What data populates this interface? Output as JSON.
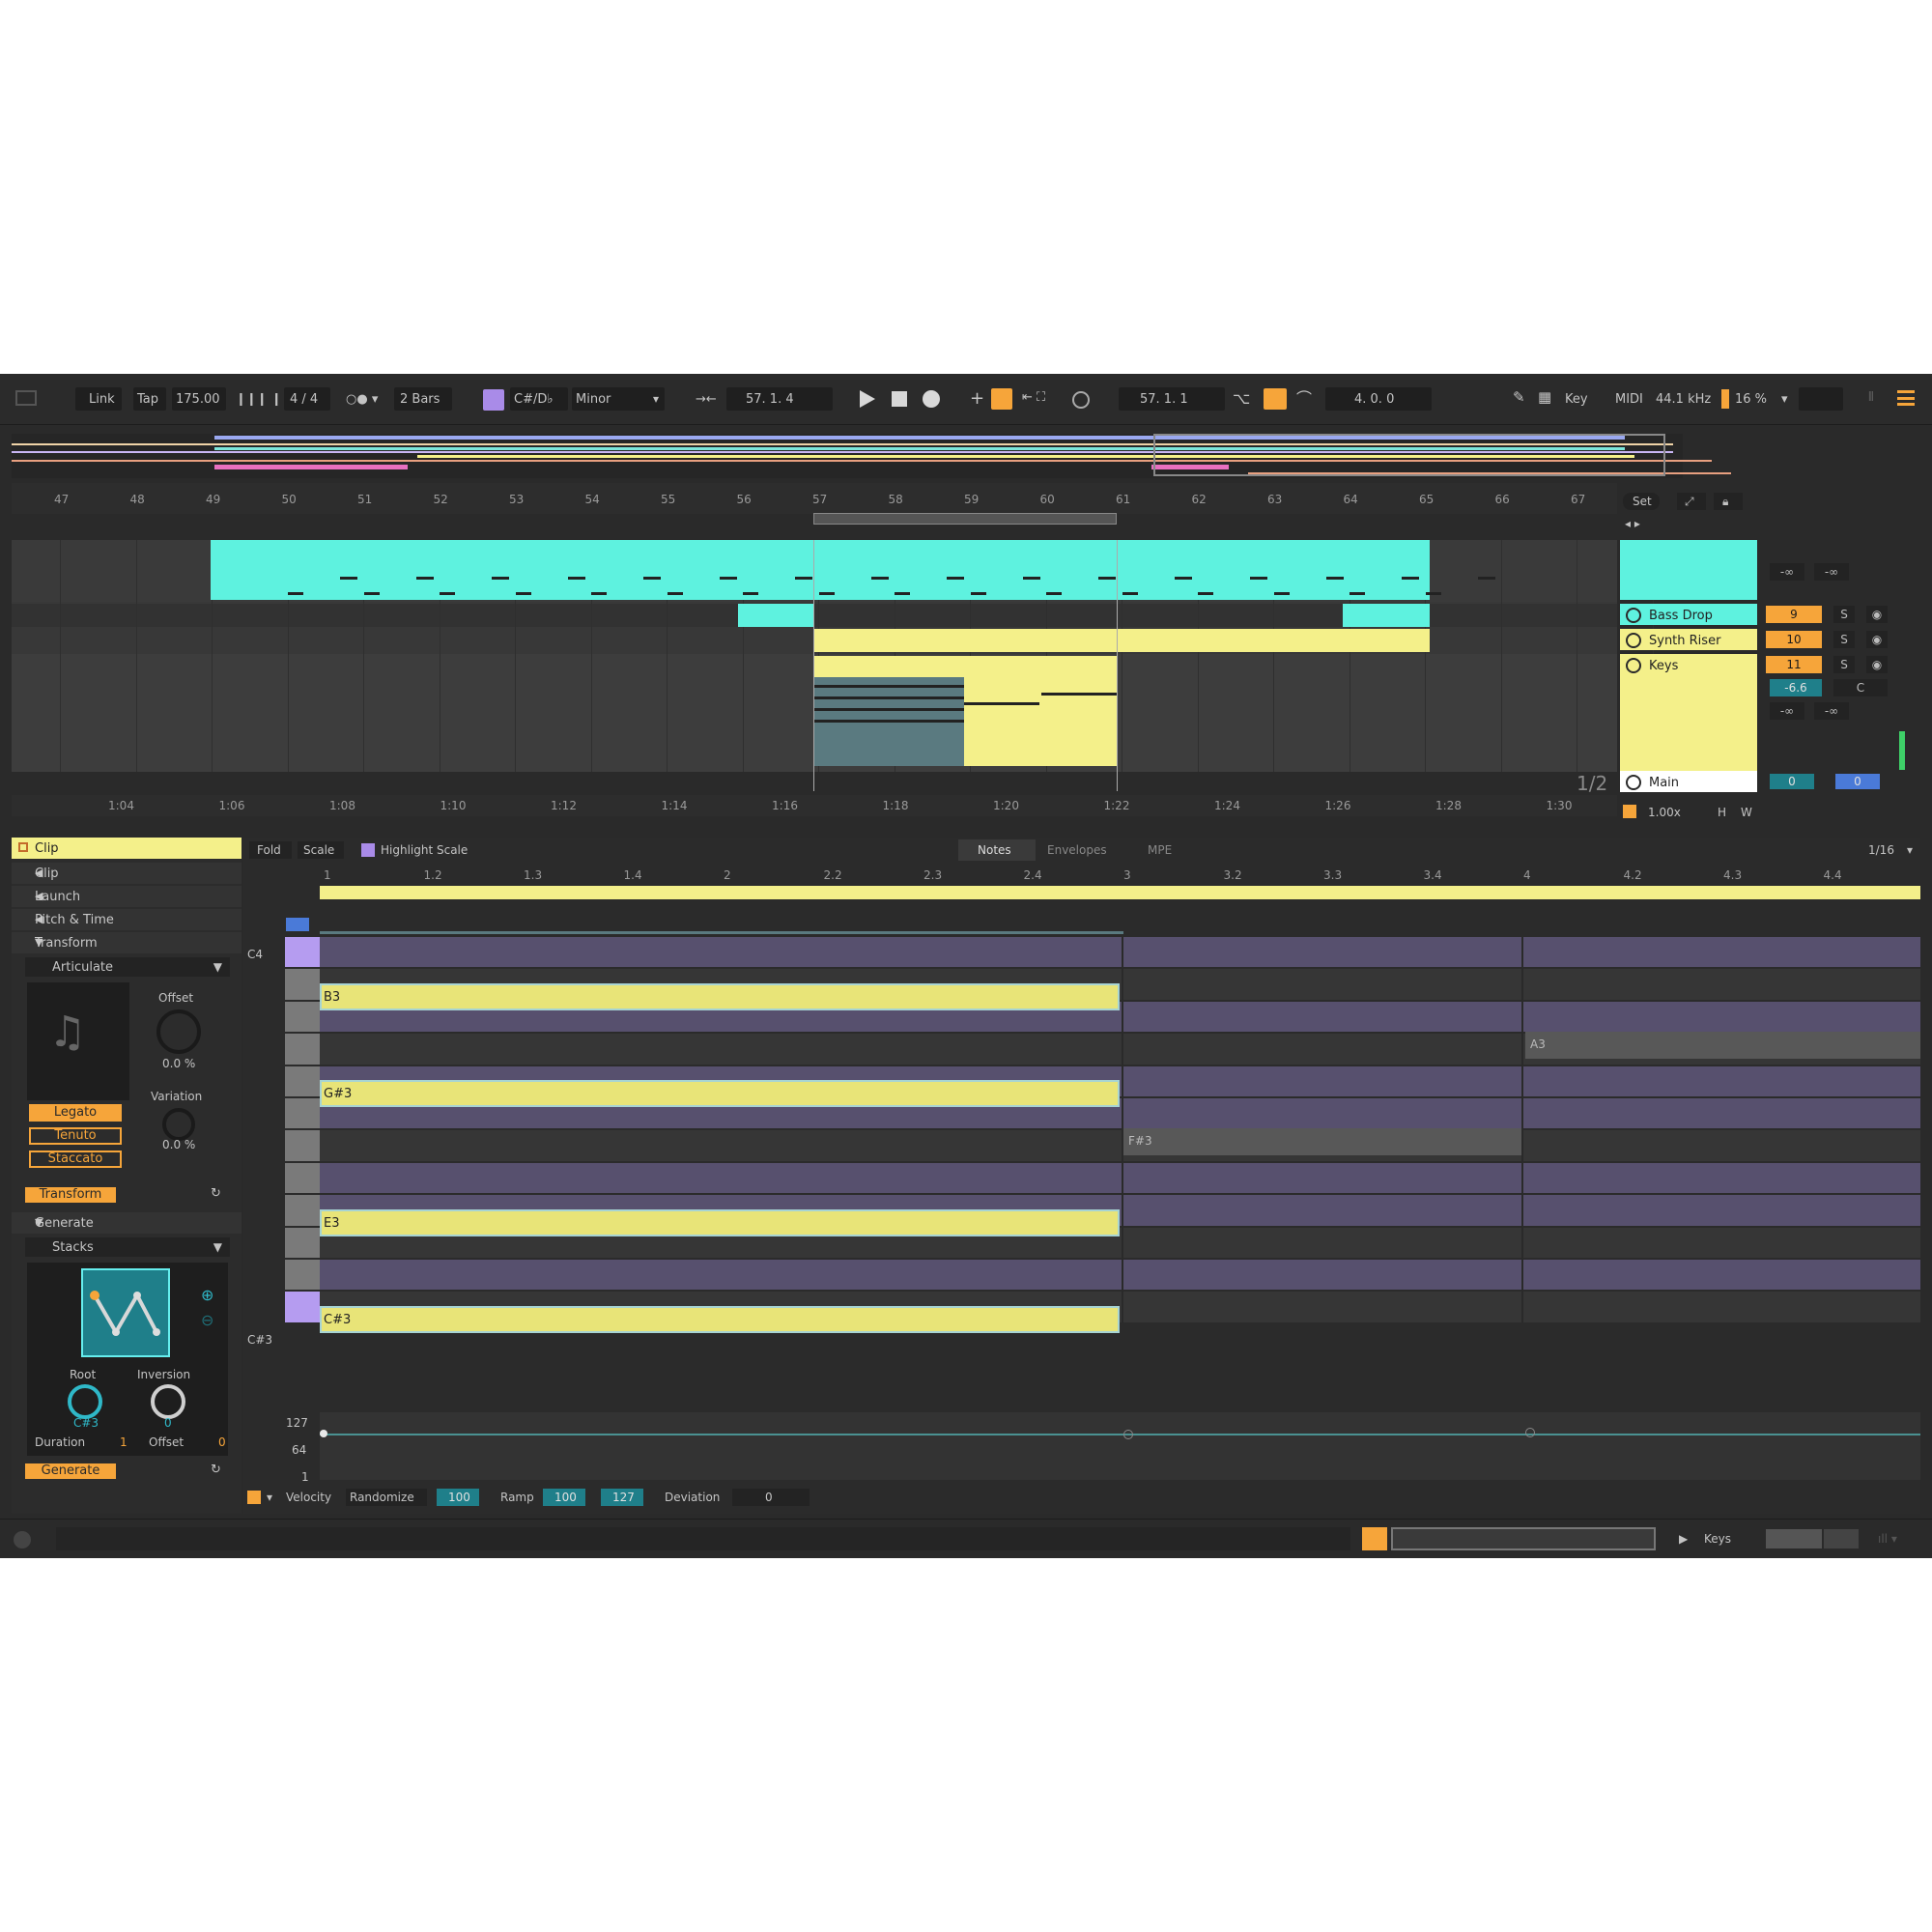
{
  "toolbar": {
    "link": "Link",
    "tap": "Tap",
    "tempo": "175.00",
    "time_signature": "4 / 4",
    "quantize": "2 Bars",
    "root": "C#/D♭",
    "scale": "Minor",
    "position": "57.  1.  4",
    "loop_start": "57.  1.  1",
    "loop_length": "4.  0.  0",
    "key": "Key",
    "midi": "MIDI",
    "sample_rate": "44.1 kHz",
    "cpu": "16 %"
  },
  "arrangement": {
    "bar_ticks": [
      "47",
      "48",
      "49",
      "50",
      "51",
      "52",
      "53",
      "54",
      "55",
      "56",
      "57",
      "58",
      "59",
      "60",
      "61",
      "62",
      "63",
      "64",
      "65",
      "66",
      "67"
    ],
    "time_ticks": [
      "1:04",
      "1:06",
      "1:08",
      "1:10",
      "1:12",
      "1:14",
      "1:16",
      "1:18",
      "1:20",
      "1:22",
      "1:24",
      "1:26",
      "1:28",
      "1:30"
    ],
    "set_label": "Set",
    "page_indicator": "1/2",
    "tracks": [
      {
        "name": "Bass Drop",
        "number": "9",
        "color": "#5ef2df"
      },
      {
        "name": "Synth Riser",
        "number": "10",
        "color": "#f4f08a"
      },
      {
        "name": "Keys",
        "number": "11",
        "color": "#f4f08a",
        "volume": "-6.6",
        "pan": "C"
      },
      {
        "name": "Main",
        "number": "0",
        "color": "#ffffff",
        "sends": "0"
      }
    ],
    "top_track_values": [
      "-∞",
      "-∞"
    ],
    "keys_values": [
      "-∞",
      "-∞"
    ],
    "solo_label": "S",
    "zoom": "1.00x",
    "h_label": "H",
    "w_label": "W"
  },
  "device_panel": {
    "sections": [
      "Clip",
      "Clip",
      "Launch",
      "Pitch & Time",
      "Transform"
    ],
    "articulate": "Articulate",
    "offset_label": "Offset",
    "offset_value": "0.0 %",
    "variation_label": "Variation",
    "variation_value": "0.0 %",
    "modes": [
      "Legato",
      "Tenuto",
      "Staccato"
    ],
    "transform_button": "Transform",
    "generate_section": "Generate",
    "stacks": "Stacks",
    "root_label": "Root",
    "root_value": "C#3",
    "inversion_label": "Inversion",
    "inversion_value": "0",
    "duration_label": "Duration",
    "duration_value": "1",
    "offset2_label": "Offset",
    "offset2_value": "0",
    "generate_button": "Generate"
  },
  "editor": {
    "fold": "Fold",
    "scale": "Scale",
    "highlight_scale": "Highlight Scale",
    "tabs": [
      "Notes",
      "Envelopes",
      "MPE"
    ],
    "grid": "1/16",
    "beat_ticks": [
      "1",
      "1.2",
      "1.3",
      "1.4",
      "2",
      "2.2",
      "2.3",
      "2.4",
      "3",
      "3.2",
      "3.3",
      "3.4",
      "4",
      "4.2",
      "4.3",
      "4.4"
    ],
    "pitch_labels": [
      "C4",
      "C#3"
    ],
    "notes": [
      {
        "label": "B3"
      },
      {
        "label": "G#3"
      },
      {
        "label": "E3"
      },
      {
        "label": "C#3"
      }
    ],
    "ghost_notes": [
      {
        "label": "A3"
      },
      {
        "label": "F#3"
      }
    ],
    "velocity_scale": [
      "127",
      "64",
      "1"
    ],
    "velocity_label": "Velocity",
    "randomize": "Randomize",
    "randomize_value": "100",
    "ramp": "Ramp",
    "ramp_start": "100",
    "ramp_end": "127",
    "deviation": "Deviation",
    "deviation_value": "0"
  },
  "statusbar": {
    "track_name": "Keys"
  },
  "colors": {
    "accent": "#f6a53a",
    "cyan": "#5ef2df",
    "yellow": "#f4f08a",
    "purple": "#b59cf0"
  }
}
